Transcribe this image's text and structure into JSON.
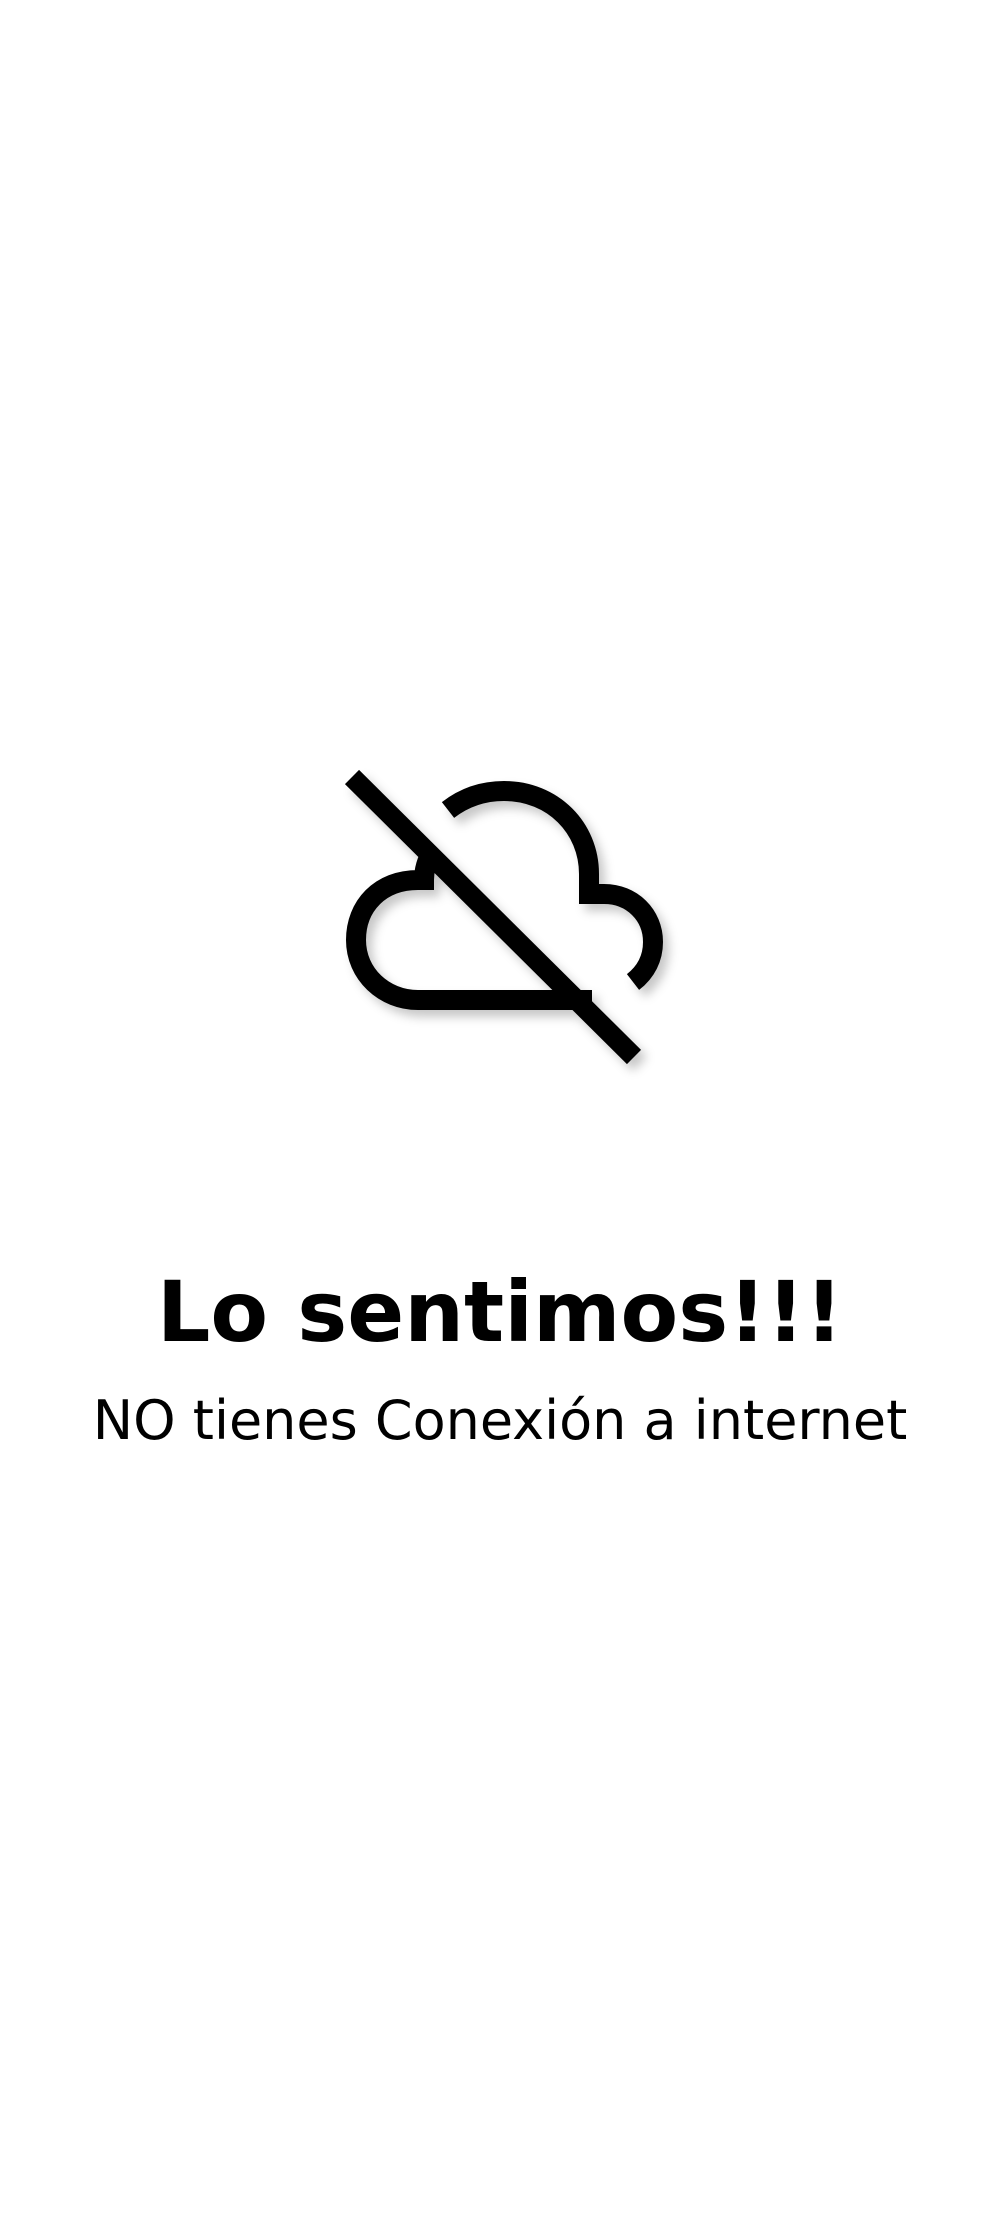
{
  "screen": {
    "icon": "cloud-off-icon",
    "title": "Lo sentimos!!!",
    "message": "NO tienes Conexión a internet"
  }
}
